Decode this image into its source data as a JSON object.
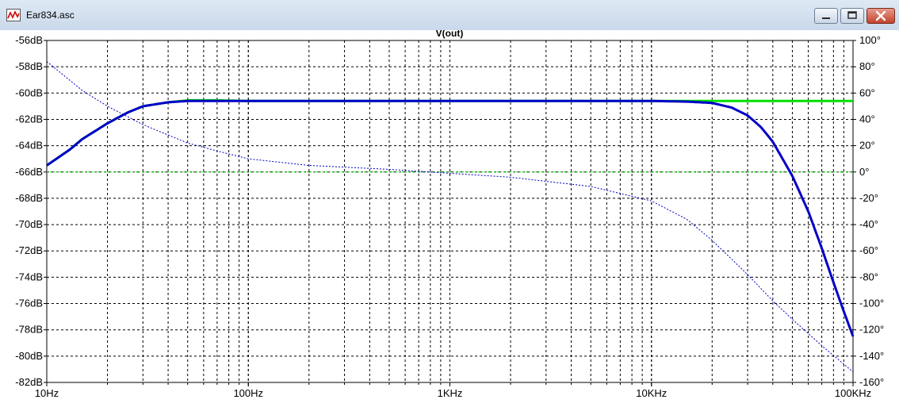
{
  "window": {
    "title": "Ear834.asc",
    "minimize_icon": "minimize-icon",
    "maximize_icon": "restore-icon",
    "close_icon": "close-icon",
    "app_icon": "waveform-icon"
  },
  "chart_data": {
    "type": "line",
    "title": "V(out)",
    "title_color": "#00cc00",
    "x_scale": "log",
    "xlim": [
      10,
      100000
    ],
    "x_tick_values": [
      10,
      100,
      1000,
      10000,
      100000
    ],
    "x_tick_labels": [
      "10Hz",
      "100Hz",
      "1KHz",
      "10KHz",
      "100KHz"
    ],
    "y_left_lim": [
      -82,
      -56
    ],
    "y_left_ticks": [
      "-56dB",
      "-58dB",
      "-60dB",
      "-62dB",
      "-64dB",
      "-66dB",
      "-68dB",
      "-70dB",
      "-72dB",
      "-74dB",
      "-76dB",
      "-78dB",
      "-80dB",
      "-82dB"
    ],
    "y_right_lim": [
      -160,
      100
    ],
    "y_right_ticks": [
      "100°",
      "80°",
      "60°",
      "40°",
      "20°",
      "0°",
      "-20°",
      "-40°",
      "-60°",
      "-80°",
      "-100°",
      "-120°",
      "-140°",
      "-160°"
    ],
    "grid": true,
    "series": [
      {
        "color": "#00e000",
        "style": "solid-magnitude",
        "x": [
          10,
          13,
          15,
          20,
          25,
          30,
          40,
          50,
          70,
          100,
          200,
          1000,
          10000,
          100000
        ],
        "y": [
          -65.5,
          -64.3,
          -63.5,
          -62.3,
          -61.5,
          -61.0,
          -60.7,
          -60.55,
          -60.55,
          -60.6,
          -60.6,
          -60.6,
          -60.6,
          -60.6
        ]
      },
      {
        "color": "#00e000",
        "style": "dashed-phase",
        "x": [
          10,
          100000
        ],
        "y": [
          0,
          0
        ]
      },
      {
        "color": "#0000c8",
        "style": "solid-magnitude",
        "x": [
          10,
          13,
          15,
          20,
          25,
          30,
          40,
          50,
          70,
          100,
          1000,
          10000,
          15000,
          20000,
          25000,
          30000,
          35000,
          40000,
          50000,
          60000,
          70000,
          80000,
          90000,
          100000
        ],
        "y": [
          -65.5,
          -64.3,
          -63.5,
          -62.3,
          -61.5,
          -61.0,
          -60.7,
          -60.6,
          -60.6,
          -60.6,
          -60.6,
          -60.6,
          -60.65,
          -60.75,
          -61.1,
          -61.7,
          -62.6,
          -63.7,
          -66.3,
          -69.0,
          -71.8,
          -74.4,
          -76.6,
          -78.5
        ]
      },
      {
        "color": "#0000c8",
        "style": "dashed-phase",
        "x": [
          10,
          15,
          20,
          30,
          50,
          70,
          100,
          200,
          500,
          1000,
          2000,
          5000,
          10000,
          15000,
          20000,
          30000,
          40000,
          50000,
          70000,
          100000
        ],
        "y": [
          84,
          62,
          50,
          36,
          22,
          16,
          10,
          5,
          2,
          -1,
          -4,
          -11,
          -22,
          -36,
          -52,
          -78,
          -98,
          -112,
          -132,
          -152
        ]
      }
    ]
  }
}
